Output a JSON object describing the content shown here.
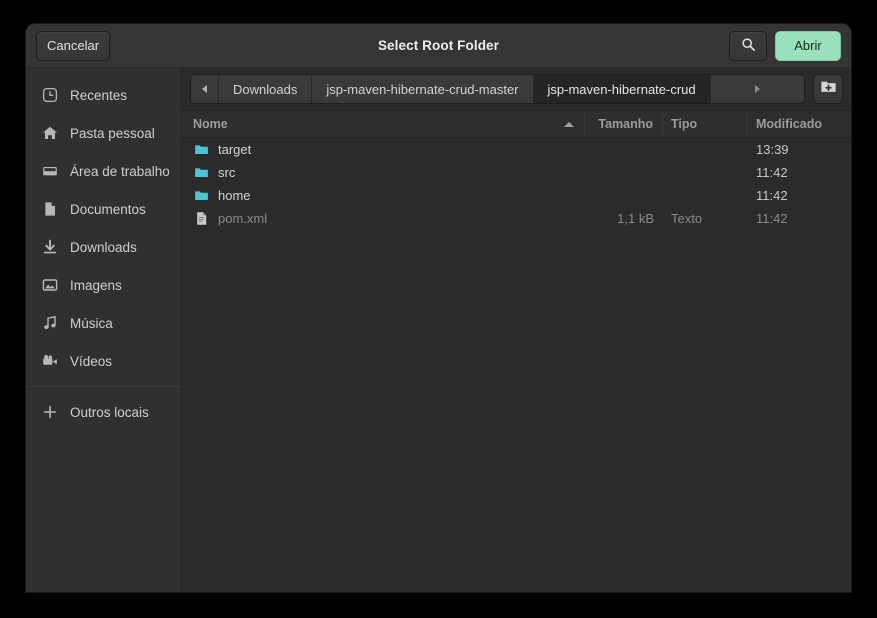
{
  "window": {
    "title": "Select Root Folder"
  },
  "header": {
    "cancel_label": "Cancelar",
    "open_label": "Abrir",
    "search_icon": "search-icon",
    "new_folder_icon": "new-folder-icon"
  },
  "sidebar": {
    "items": [
      {
        "label": "Recentes",
        "icon": "clock-icon"
      },
      {
        "label": "Pasta pessoal",
        "icon": "home-icon"
      },
      {
        "label": "Área de trabalho",
        "icon": "desktop-icon"
      },
      {
        "label": "Documentos",
        "icon": "document-icon"
      },
      {
        "label": "Downloads",
        "icon": "download-icon"
      },
      {
        "label": "Imagens",
        "icon": "image-icon"
      },
      {
        "label": "Música",
        "icon": "music-note-icon"
      },
      {
        "label": "Vídeos",
        "icon": "video-camera-icon"
      }
    ],
    "other_locations": {
      "label": "Outros locais",
      "icon": "plus-icon"
    }
  },
  "pathbar": {
    "back_arrow": "chevron-left-icon",
    "forward_arrow": "chevron-right-icon",
    "crumbs": [
      {
        "label": "Downloads",
        "active": false
      },
      {
        "label": "jsp-maven-hibernate-crud-master",
        "active": false
      },
      {
        "label": "jsp-maven-hibernate-crud",
        "active": true
      }
    ]
  },
  "filelist": {
    "columns": {
      "name": "Nome",
      "size": "Tamanho",
      "type": "Tipo",
      "modified": "Modificado"
    },
    "sort": {
      "column": "Nome",
      "direction": "ascending"
    },
    "rows": [
      {
        "name": "target",
        "size": "",
        "type": "",
        "modified": "13:39",
        "icon": "folder-icon",
        "dimmed": false
      },
      {
        "name": "src",
        "size": "",
        "type": "",
        "modified": "11:42",
        "icon": "folder-icon",
        "dimmed": false
      },
      {
        "name": "home",
        "size": "",
        "type": "",
        "modified": "11:42",
        "icon": "folder-icon",
        "dimmed": false
      },
      {
        "name": "pom.xml",
        "size": "1,1 kB",
        "type": "Texto",
        "modified": "11:42",
        "icon": "file-icon",
        "dimmed": true
      }
    ]
  },
  "colors": {
    "accent_open_button": "#9ae0bd",
    "folder_icon": "#4ec3d4",
    "dialog_background": "#353535",
    "list_background": "#2b2b2b"
  }
}
